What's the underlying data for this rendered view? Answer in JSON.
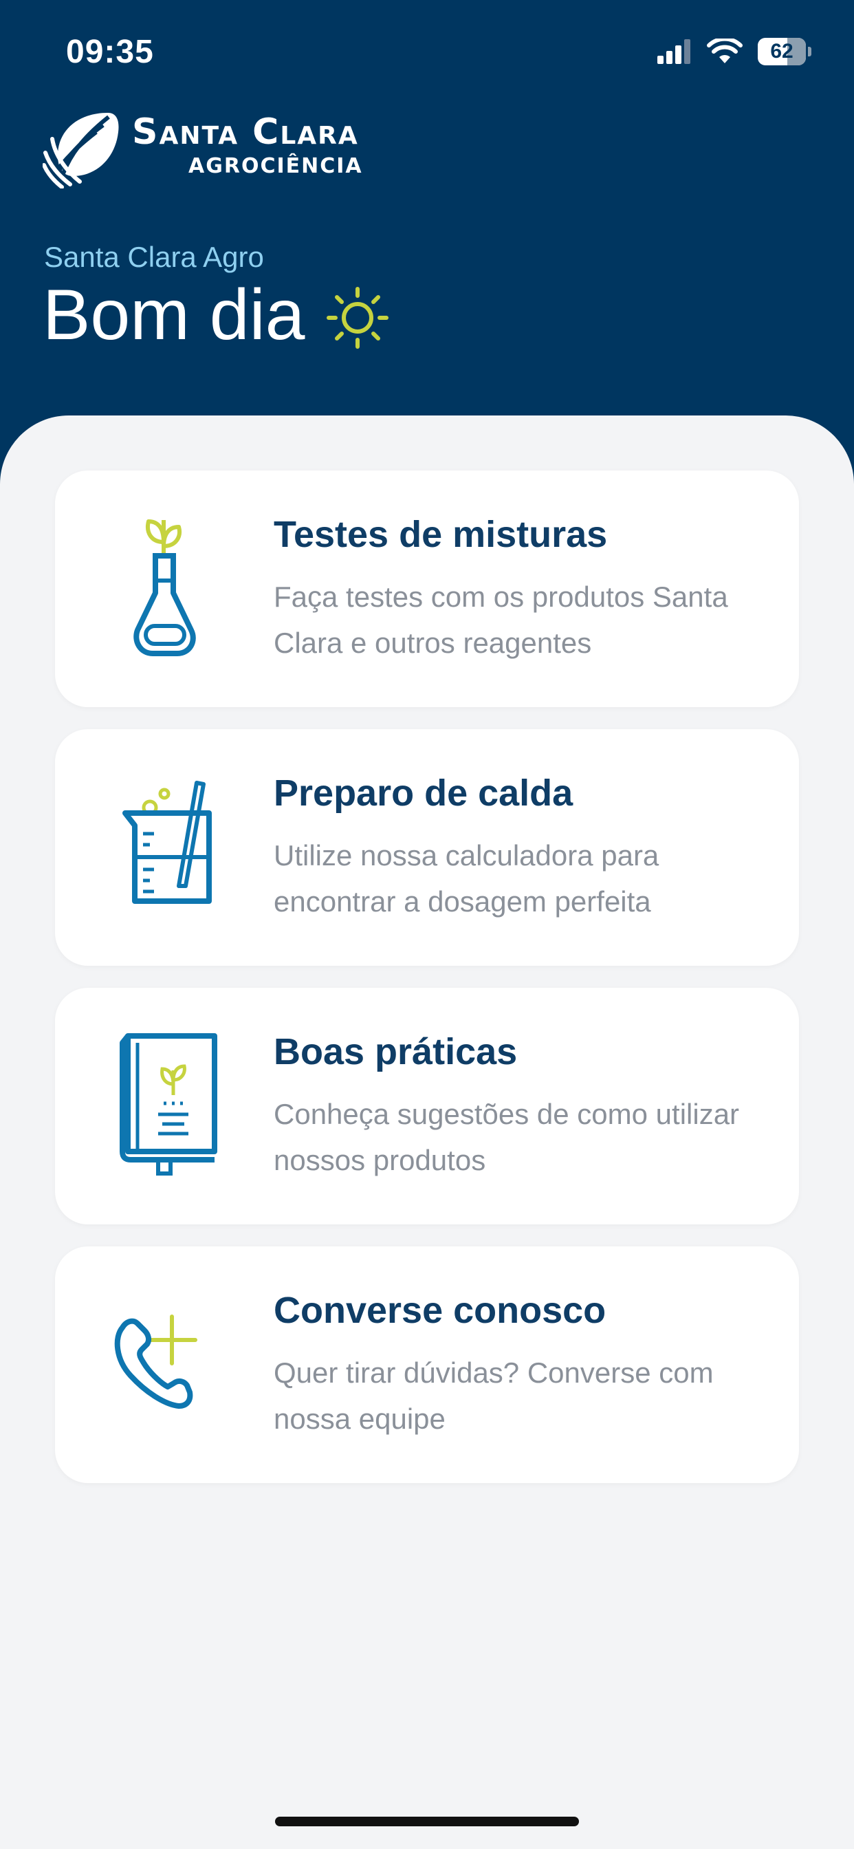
{
  "status_bar": {
    "time": "09:35",
    "battery_percent": "62",
    "battery_level": 0.62,
    "signal_bars_filled": 3,
    "icons": [
      "signal-icon",
      "wifi-icon",
      "battery-icon"
    ]
  },
  "brand": {
    "name": "Santa Clara",
    "sub": "AGROCIÊNCIA",
    "logo_icon": "leaf-logo-icon"
  },
  "greeting": {
    "subtitle": "Santa Clara Agro",
    "title": "Bom dia",
    "icon": "sun-icon"
  },
  "colors": {
    "header_bg": "#003660",
    "accent_blue": "#0e76b0",
    "accent_lime": "#c6d33f",
    "title_navy": "#0f3d66",
    "desc_grey": "#8a9099",
    "page_bg": "#f3f4f6",
    "greeting_sub": "#8fd0f0"
  },
  "cards": [
    {
      "icon": "flask-plant-icon",
      "title": "Testes de misturas",
      "description": "Faça testes com os produtos Santa Clara e outros reagentes"
    },
    {
      "icon": "beaker-calculator-icon",
      "title": "Preparo de calda",
      "description": "Utilize nossa calculadora para encontrar a dosagem perfeita"
    },
    {
      "icon": "book-icon",
      "title": "Boas práticas",
      "description": "Conheça sugestões de como utilizar nossos produtos"
    },
    {
      "icon": "phone-plus-icon",
      "title": "Converse conosco",
      "description": "Quer tirar dúvidas? Converse com nossa equipe"
    }
  ]
}
